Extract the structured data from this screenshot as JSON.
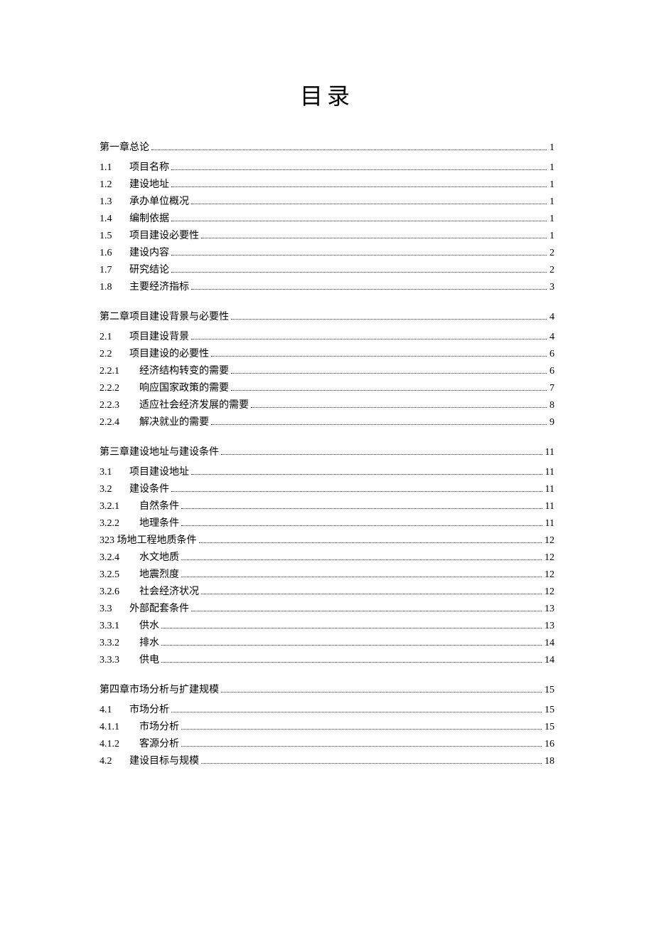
{
  "title": "目录",
  "entries": [
    {
      "level": 0,
      "num": "",
      "text": "第一章总论",
      "page": "1",
      "chapter": true
    },
    {
      "level": 1,
      "num": "1.1",
      "text": "项目名称",
      "page": "1"
    },
    {
      "level": 1,
      "num": "1.2",
      "text": "建设地址",
      "page": "1"
    },
    {
      "level": 1,
      "num": "1.3",
      "text": "承办单位概况",
      "page": "1"
    },
    {
      "level": 1,
      "num": "1.4",
      "text": "编制依据",
      "page": "1"
    },
    {
      "level": 1,
      "num": "1.5",
      "text": "项目建设必要性",
      "page": "1"
    },
    {
      "level": 1,
      "num": "1.6",
      "text": "建设内容",
      "page": "2"
    },
    {
      "level": 1,
      "num": "1.7",
      "text": "研究结论",
      "page": "2"
    },
    {
      "level": 1,
      "num": "1.8",
      "text": "主要经济指标",
      "page": "3"
    },
    {
      "level": 0,
      "num": "",
      "text": "第二章项目建设背景与必要性",
      "page": "4",
      "chapter": true
    },
    {
      "level": 1,
      "num": "2.1",
      "text": "项目建设背景",
      "page": "4"
    },
    {
      "level": 1,
      "num": "2.2",
      "text": "项目建设的必要性",
      "page": "6"
    },
    {
      "level": 2,
      "num": "2.2.1",
      "text": "经济结构转变的需要",
      "page": "6"
    },
    {
      "level": 2,
      "num": "2.2.2",
      "text": "响应国家政策的需要",
      "page": "7"
    },
    {
      "level": 2,
      "num": "2.2.3",
      "text": "适应社会经济发展的需要",
      "page": "8"
    },
    {
      "level": 2,
      "num": "2.2.4",
      "text": "解决就业的需要",
      "page": "9"
    },
    {
      "level": 0,
      "num": "",
      "text": "第三章建设地址与建设条件",
      "page": "11",
      "chapter": true
    },
    {
      "level": 1,
      "num": "3.1",
      "text": "项目建设地址",
      "page": "11"
    },
    {
      "level": 1,
      "num": "3.2",
      "text": "建设条件",
      "page": "11"
    },
    {
      "level": 2,
      "num": "3.2.1",
      "text": "自然条件",
      "page": "11"
    },
    {
      "level": 2,
      "num": "3.2.2",
      "text": "地理条件",
      "page": "11"
    },
    {
      "level": 0,
      "num": "",
      "text": "323 场地工程地质条件",
      "page": "12"
    },
    {
      "level": 2,
      "num": "3.2.4",
      "text": "水文地质",
      "page": "12"
    },
    {
      "level": 2,
      "num": "3.2.5",
      "text": "地震烈度",
      "page": "12"
    },
    {
      "level": 2,
      "num": "3.2.6",
      "text": "社会经济状况",
      "page": "12"
    },
    {
      "level": 1,
      "num": "3.3",
      "text": "外部配套条件",
      "page": "13"
    },
    {
      "level": 2,
      "num": "3.3.1",
      "text": "供水",
      "page": "13"
    },
    {
      "level": 2,
      "num": "3.3.2",
      "text": "排水",
      "page": "14"
    },
    {
      "level": 2,
      "num": "3.3.3",
      "text": "供电",
      "page": "14"
    },
    {
      "level": 0,
      "num": "",
      "text": "第四章市场分析与扩建规模",
      "page": "15",
      "chapter": true
    },
    {
      "level": 1,
      "num": "4.1",
      "text": "市场分析",
      "page": "15"
    },
    {
      "level": 2,
      "num": "4.1.1",
      "text": "市场分析",
      "page": "15"
    },
    {
      "level": 2,
      "num": "4.1.2",
      "text": "客源分析",
      "page": "16"
    },
    {
      "level": 1,
      "num": "4.2",
      "text": "建设目标与规模",
      "page": "18"
    }
  ]
}
